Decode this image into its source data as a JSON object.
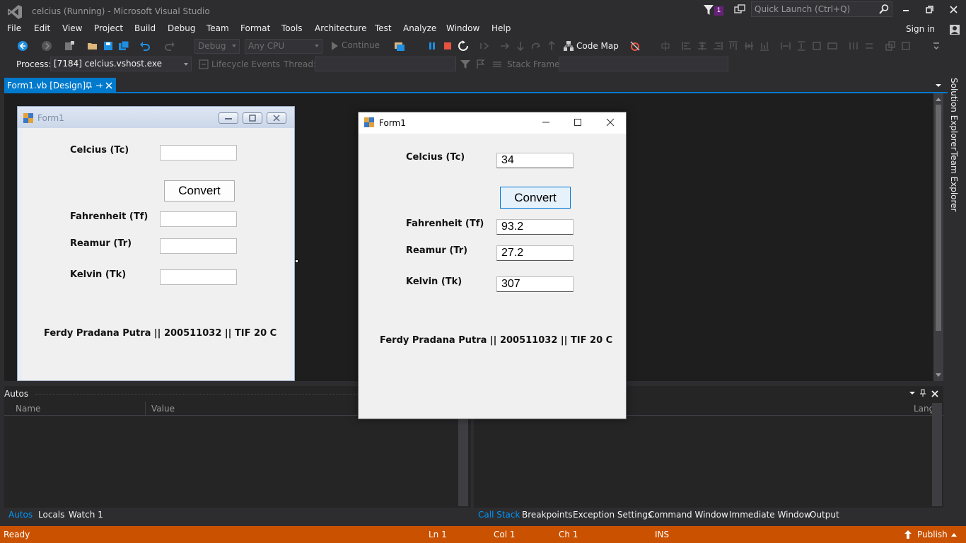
{
  "window": {
    "title": "celcius (Running) - Microsoft Visual Studio",
    "notification_count": "1",
    "quick_launch_placeholder": "Quick Launch (Ctrl+Q)"
  },
  "menu": [
    "File",
    "Edit",
    "View",
    "Project",
    "Build",
    "Debug",
    "Team",
    "Format",
    "Tools",
    "Architecture",
    "Test",
    "Analyze",
    "Window",
    "Help"
  ],
  "account": {
    "sign_in": "Sign in"
  },
  "toolbar": {
    "config": "Debug",
    "platform": "Any CPU",
    "continue": "Continue",
    "code_map": "Code Map"
  },
  "debug_location": {
    "process_label": "Process:",
    "process_value": "[7184] celcius.vshost.exe",
    "lifecycle": "Lifecycle Events",
    "thread_label": "Thread:",
    "stack_frame_label": "Stack Frame:"
  },
  "doc_tab": {
    "label": "Form1.vb [Design]"
  },
  "side_tabs": [
    "Solution Explorer",
    "Team Explorer"
  ],
  "design_form": {
    "caption": "Form1",
    "celcius_label": "Celcius (Tc)",
    "convert_label": "Convert",
    "fahrenheit_label": "Fahrenheit (Tf)",
    "reamur_label": "Reamur (Tr)",
    "kelvin_label": "Kelvin (Tk)",
    "footer": "Ferdy Pradana Putra || 200511032 || TIF 20 C"
  },
  "run_form": {
    "caption": "Form1",
    "celcius_label": "Celcius (Tc)",
    "celcius_value": "34",
    "convert_label": "Convert",
    "fahrenheit_label": "Fahrenheit (Tf)",
    "fahrenheit_value": "93.2",
    "reamur_label": "Reamur (Tr)",
    "reamur_value": "27.2",
    "kelvin_label": "Kelvin (Tk)",
    "kelvin_value": "307",
    "footer": "Ferdy Pradana Putra || 200511032 || TIF 20 C"
  },
  "autos": {
    "title": "Autos",
    "columns": [
      "Name",
      "Value"
    ]
  },
  "callstack": {
    "lang_column": "Lang"
  },
  "bottom_tabs_left": [
    "Autos",
    "Locals",
    "Watch 1"
  ],
  "bottom_tabs_right": [
    "Call Stack",
    "Breakpoints",
    "Exception Settings",
    "Command Window",
    "Immediate Window",
    "Output"
  ],
  "status": {
    "ready": "Ready",
    "line": "Ln 1",
    "col": "Col 1",
    "ch": "Ch 1",
    "ins": "INS",
    "publish": "Publish"
  },
  "colors": {
    "accent": "#007acc",
    "status_bar": "#ca5100",
    "active_tab_text": "#0097fb"
  }
}
